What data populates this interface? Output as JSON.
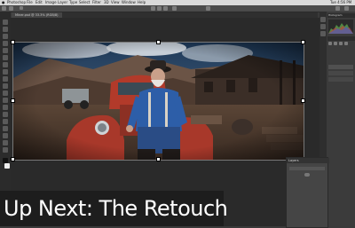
{
  "menubar": {
    "items": [
      "Photoshop",
      "File",
      "Edit",
      "Image",
      "Layer",
      "Type",
      "Select",
      "Filter",
      "3D",
      "View",
      "Window",
      "Help"
    ],
    "clock": "Tue 4:56 PM"
  },
  "document": {
    "tab_label": "Miner.psd @ 33.3% (RGB/8)"
  },
  "panels": {
    "histogram_title": "Histogram",
    "layers_title": "Layers"
  },
  "caption": {
    "text": "Up Next: The Retouch"
  },
  "colors": {
    "app_bg": "#3a3a3a",
    "canvas_bg": "#2a2a2a",
    "caption_bg": "#1c1c1c",
    "caption_text": "#ffffff"
  }
}
